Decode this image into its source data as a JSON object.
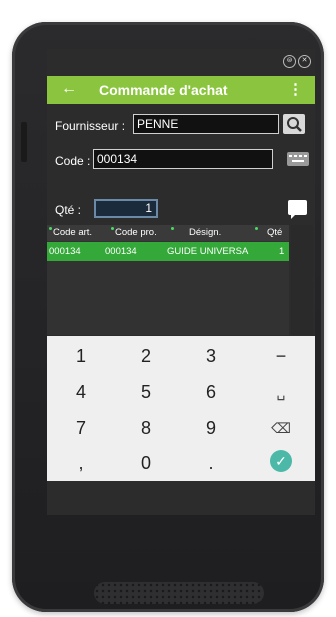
{
  "window_controls": [
    "⊜",
    "✕"
  ],
  "appbar": {
    "back": "←",
    "title": "Commande d'achat",
    "menu": "⋮"
  },
  "form": {
    "supplier_label": "Fournisseur :",
    "supplier_value": "PENNE",
    "code_label": "Code :",
    "code_value": "000134",
    "qty_label": "Qté :",
    "qty_value": "1"
  },
  "grid": {
    "columns": [
      "Code art.",
      "Code pro.",
      "Désign.",
      "Qté"
    ],
    "rows": [
      [
        "000134",
        "000134",
        "GUIDE UNIVERSA",
        "1"
      ]
    ]
  },
  "keypad": {
    "keys": [
      [
        "1",
        "2",
        "3",
        "−"
      ],
      [
        "4",
        "5",
        "6",
        "␣"
      ],
      [
        "7",
        "8",
        "9",
        "⌫"
      ],
      [
        ",",
        "0",
        ".",
        "✓"
      ]
    ]
  },
  "colors": {
    "accent": "#8bc53f",
    "row_selected": "#35a83a",
    "ok": "#4cb8a8"
  }
}
